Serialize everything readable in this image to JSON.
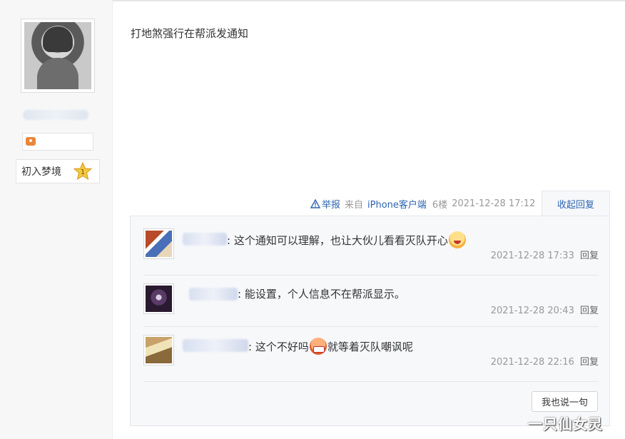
{
  "user": {
    "badge_icon": "game-controller-icon",
    "level_label": "初入梦境",
    "level_num": "1"
  },
  "post": {
    "text": "打地煞强行在帮派发通知",
    "report_label": "举报",
    "source_label": "来自iPhone客户端",
    "floor": "6楼",
    "time": "2021-12-28 17:12",
    "collapse_label": "收起回复"
  },
  "replies": [
    {
      "text_before": ": 这个通知可以理解，也让大伙儿看看灭队开心",
      "text_after": "",
      "emoji": "laughing-emoji-icon",
      "time": "2021-12-28 17:33",
      "reply_label": "回复"
    },
    {
      "text_before": ": 能设置，个人信息不在帮派显示。",
      "text_after": "",
      "emoji": "",
      "time": "2021-12-28 20:43",
      "reply_label": "回复"
    },
    {
      "text_before": ": 这个不好吗",
      "text_after": "就等着灭队嘲讽呢",
      "emoji": "angry-emoji-icon",
      "time": "2021-12-28 22:16",
      "reply_label": "回复"
    }
  ],
  "say_button": "我也说一句",
  "watermark": "一只仙女灵",
  "colors": {
    "link": "#2d64b3",
    "panel_bg": "#f7f8fa",
    "muted": "#999999"
  }
}
